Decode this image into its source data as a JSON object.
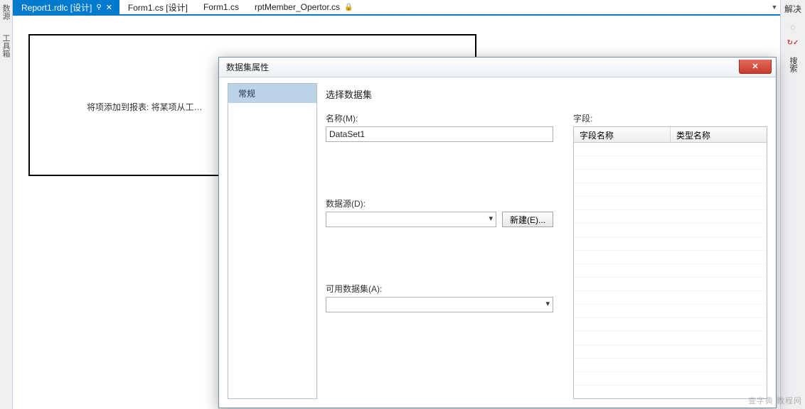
{
  "left_toolbar": {
    "label1": "数源",
    "label2": "工具箱"
  },
  "tabs": [
    {
      "label": "Report1.rdlc [设计]",
      "active": true,
      "pinned": true,
      "closeable": true
    },
    {
      "label": "Form1.cs [设计]",
      "active": false
    },
    {
      "label": "Form1.cs",
      "active": false
    },
    {
      "label": "rptMember_Opertor.cs",
      "active": false,
      "locked": true
    }
  ],
  "right_strip": {
    "title": "解决",
    "search_label": "搜索"
  },
  "design_hint": "将项添加到报表: 将某项从工…",
  "dialog": {
    "title": "数据集属性",
    "sidebar": {
      "items": [
        {
          "label": "常规",
          "active": true
        }
      ]
    },
    "section_title": "选择数据集",
    "name_label": "名称(M):",
    "name_value": "DataSet1",
    "datasource_label": "数据源(D):",
    "datasource_value": "",
    "new_button": "新建(E)...",
    "available_label": "可用数据集(A):",
    "available_value": "",
    "fields_label": "字段:",
    "fields_columns": {
      "col1": "字段名称",
      "col2": "类型名称"
    }
  },
  "watermark": "查字典  教程网"
}
